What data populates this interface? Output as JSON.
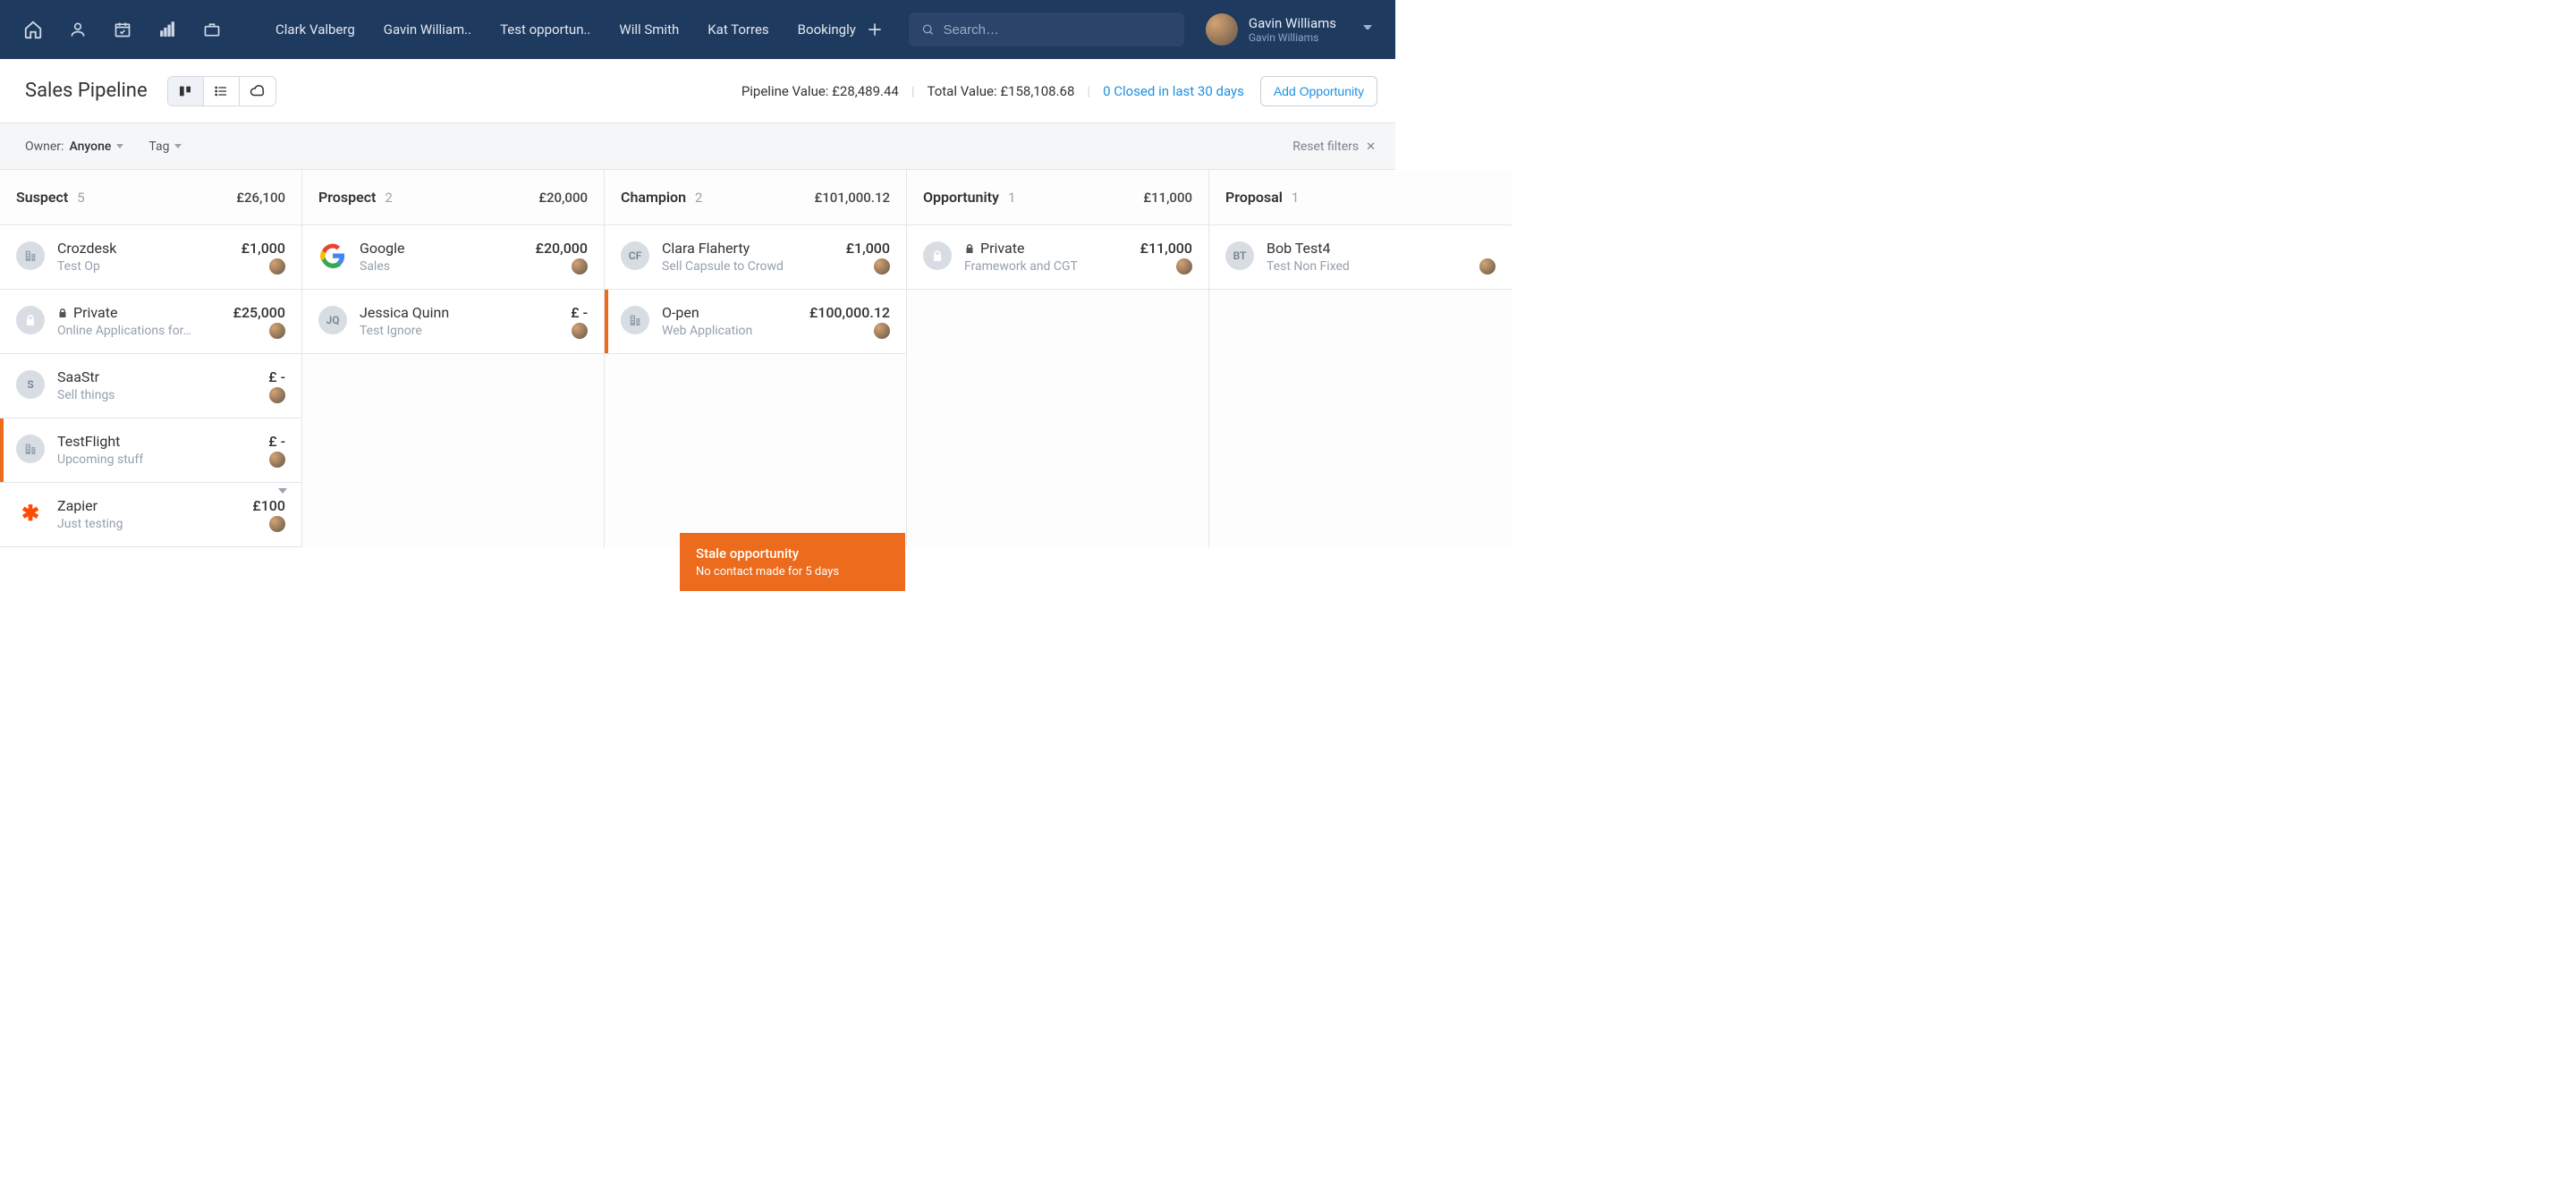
{
  "nav": {
    "links": [
      "Clark Valberg",
      "Gavin William..",
      "Test opportun..",
      "Will Smith",
      "Kat Torres",
      "Bookingly"
    ],
    "search_placeholder": "Search…"
  },
  "user": {
    "name": "Gavin Williams",
    "subname": "Gavin Williams"
  },
  "page_title": "Sales Pipeline",
  "stats": {
    "pipeline_label": "Pipeline Value:",
    "pipeline_value": "£28,489.44",
    "total_label": "Total Value:",
    "total_value": "£158,108.68",
    "closed_text": "0 Closed in last 30 days"
  },
  "buttons": {
    "add_opportunity": "Add Opportunity"
  },
  "filters": {
    "owner_label": "Owner:",
    "owner_value": "Anyone",
    "tag_label": "Tag",
    "reset": "Reset filters"
  },
  "tooltip": {
    "title": "Stale opportunity",
    "subtitle": "No contact made for 5 days"
  },
  "columns": [
    {
      "name": "Suspect",
      "count": "5",
      "total": "£26,100",
      "cards": [
        {
          "avatar_type": "building",
          "avatar_text": "",
          "title": "Crozdesk",
          "private": false,
          "value": "£1,000",
          "sub": "Test Op",
          "stale": false,
          "chev": false
        },
        {
          "avatar_type": "lock",
          "avatar_text": "",
          "title": "Private",
          "private": true,
          "value": "£25,000",
          "sub": "Online Applications for…",
          "stale": false,
          "chev": false
        },
        {
          "avatar_type": "letter",
          "avatar_text": "S",
          "title": "SaaStr",
          "private": false,
          "value": "£ -",
          "sub": "Sell things",
          "stale": false,
          "chev": false
        },
        {
          "avatar_type": "building",
          "avatar_text": "",
          "title": "TestFlight",
          "private": false,
          "value": "£ -",
          "sub": "Upcoming stuff",
          "stale": true,
          "chev": false
        },
        {
          "avatar_type": "zapier",
          "avatar_text": "✱",
          "title": "Zapier",
          "private": false,
          "value": "£100",
          "sub": "Just testing",
          "stale": false,
          "chev": true
        }
      ]
    },
    {
      "name": "Prospect",
      "count": "2",
      "total": "£20,000",
      "cards": [
        {
          "avatar_type": "google",
          "avatar_text": "G",
          "title": "Google",
          "private": false,
          "value": "£20,000",
          "sub": "Sales",
          "stale": false,
          "chev": false
        },
        {
          "avatar_type": "letter",
          "avatar_text": "JQ",
          "title": "Jessica Quinn",
          "private": false,
          "value": "£ -",
          "sub": "Test Ignore",
          "stale": false,
          "chev": false
        }
      ]
    },
    {
      "name": "Champion",
      "count": "2",
      "total": "£101,000.12",
      "cards": [
        {
          "avatar_type": "letter",
          "avatar_text": "CF",
          "title": "Clara Flaherty",
          "private": false,
          "value": "£1,000",
          "sub": "Sell Capsule to Crowd",
          "stale": false,
          "chev": false
        },
        {
          "avatar_type": "building",
          "avatar_text": "",
          "title": "O-pen",
          "private": false,
          "value": "£100,000.12",
          "sub": "Web Application",
          "stale": true,
          "chev": false
        }
      ]
    },
    {
      "name": "Opportunity",
      "count": "1",
      "total": "£11,000",
      "cards": [
        {
          "avatar_type": "lock",
          "avatar_text": "",
          "title": "Private",
          "private": true,
          "value": "£11,000",
          "sub": "Framework and CGT",
          "stale": false,
          "chev": false
        }
      ]
    },
    {
      "name": "Proposal",
      "count": "1",
      "total": "",
      "cards": [
        {
          "avatar_type": "letter",
          "avatar_text": "BT",
          "title": "Bob Test4",
          "private": false,
          "value": "",
          "sub": "Test Non Fixed",
          "stale": false,
          "chev": false
        }
      ]
    }
  ]
}
